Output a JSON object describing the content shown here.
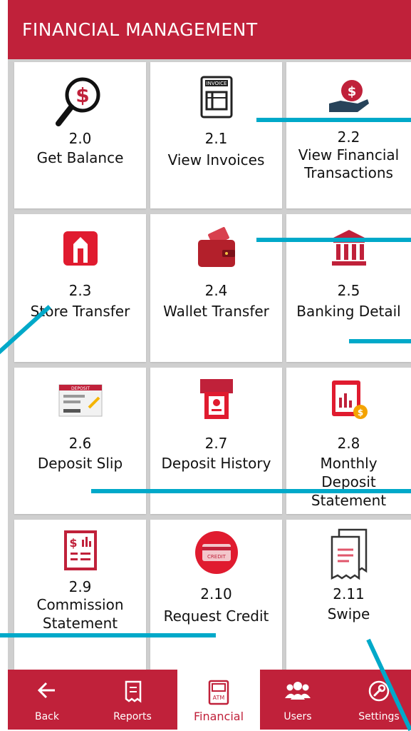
{
  "header": {
    "title": "FINANCIAL MANAGEMENT"
  },
  "tiles": [
    {
      "num": "2.0",
      "label": "Get Balance",
      "icon": "balance-search-icon"
    },
    {
      "num": "2.1",
      "label": "View Invoices",
      "icon": "invoice-icon"
    },
    {
      "num": "2.2",
      "label": "View Financial",
      "label2": "Transactions",
      "icon": "financial-hand-icon"
    },
    {
      "num": "2.3",
      "label": "Store Transfer",
      "icon": "store-transfer-icon"
    },
    {
      "num": "2.4",
      "label": "Wallet Transfer",
      "icon": "wallet-icon"
    },
    {
      "num": "2.5",
      "label": "Banking Detail",
      "icon": "bank-icon"
    },
    {
      "num": "2.6",
      "label": "Deposit Slip",
      "icon": "deposit-slip-icon"
    },
    {
      "num": "2.7",
      "label": "Deposit History",
      "icon": "atm-deposit-icon"
    },
    {
      "num": "2.8",
      "label": "Monthly",
      "label2": "Deposit",
      "label3": "Statement",
      "icon": "monthly-statement-icon"
    },
    {
      "num": "2.9",
      "label": "Commission",
      "label2": "Statement",
      "icon": "commission-statement-icon"
    },
    {
      "num": "2.10",
      "label": "Request Credit",
      "icon": "credit-card-icon"
    },
    {
      "num": "2.11",
      "label": "Swipe",
      "icon": "receipt-icon"
    }
  ],
  "nav": {
    "back": "Back",
    "reports": "Reports",
    "financial": "Financial",
    "users": "Users",
    "settings": "Settings"
  },
  "icon_texts": {
    "invoice": "INVOICE",
    "deposit": "DEPOSIT",
    "credit": "CREDIT",
    "atm": "ATM"
  },
  "colors": {
    "brand": "#c0213a",
    "callout": "#00a9c9",
    "nav_active_bg": "#ffffff"
  }
}
